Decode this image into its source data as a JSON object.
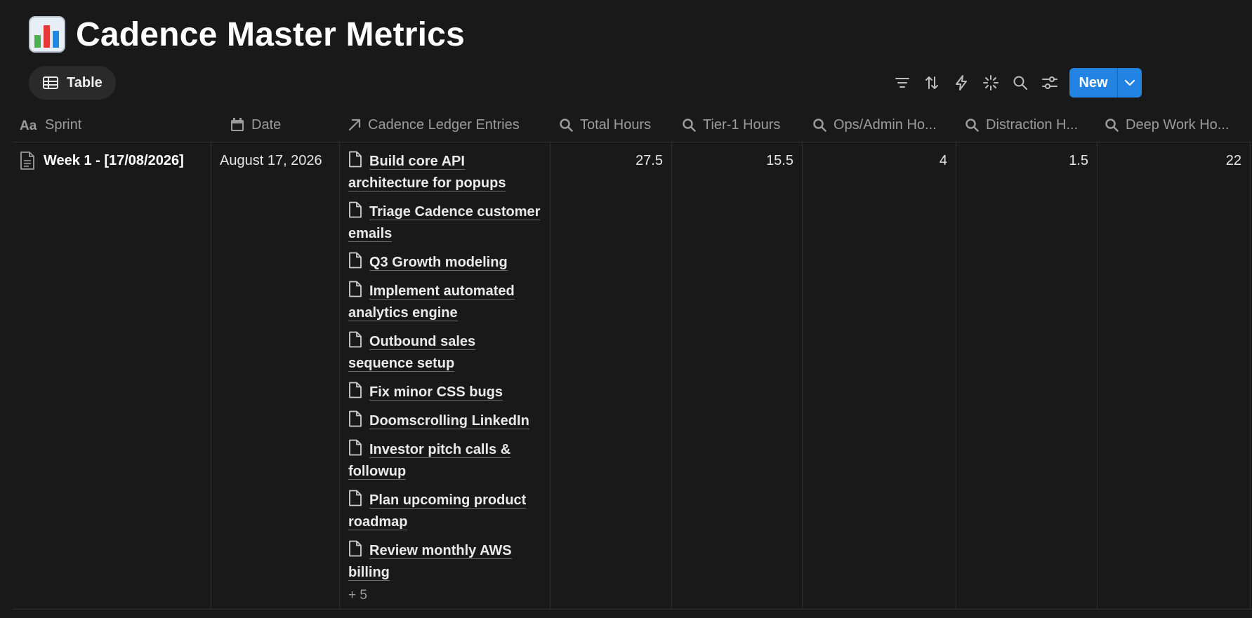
{
  "page": {
    "title": "Cadence Master Metrics",
    "emoji": "bar-chart-emoji"
  },
  "toolbar": {
    "view_tab_label": "Table",
    "icons": [
      "filter-icon",
      "sort-icon",
      "lightning-icon",
      "automation-sparkle-icon",
      "search-icon",
      "settings-sliders-icon"
    ],
    "new_label": "New",
    "accent_color": "#2383e2"
  },
  "table": {
    "columns": [
      {
        "label": "Sprint",
        "icon": "title-aa-icon"
      },
      {
        "label": "Date",
        "icon": "calendar-icon"
      },
      {
        "label": "Cadence Ledger Entries",
        "icon": "relation-arrow-icon"
      },
      {
        "label": "Total Hours",
        "icon": "rollup-search-icon"
      },
      {
        "label": "Tier-1 Hours",
        "icon": "rollup-search-icon"
      },
      {
        "label": "Ops/Admin Ho...",
        "icon": "rollup-search-icon"
      },
      {
        "label": "Distraction H...",
        "icon": "rollup-search-icon"
      },
      {
        "label": "Deep Work Ho...",
        "icon": "rollup-search-icon"
      }
    ],
    "rows": [
      {
        "sprint": "Week 1 - [17/08/2026]",
        "date": "August 17, 2026",
        "ledger_entries": [
          "Build core API architecture for popups",
          "Triage Cadence customer emails",
          "Q3 Growth modeling",
          "Implement automated analytics engine",
          "Outbound sales sequence setup",
          "Fix minor CSS bugs",
          "Doomscrolling LinkedIn",
          "Investor pitch calls & followup",
          "Plan upcoming product roadmap",
          "Review monthly AWS billing"
        ],
        "ledger_more": "+ 5",
        "total_hours": "27.5",
        "tier1_hours": "15.5",
        "ops_admin_hours": "4",
        "distraction_hours": "1.5",
        "deep_work_hours": "22"
      }
    ]
  }
}
